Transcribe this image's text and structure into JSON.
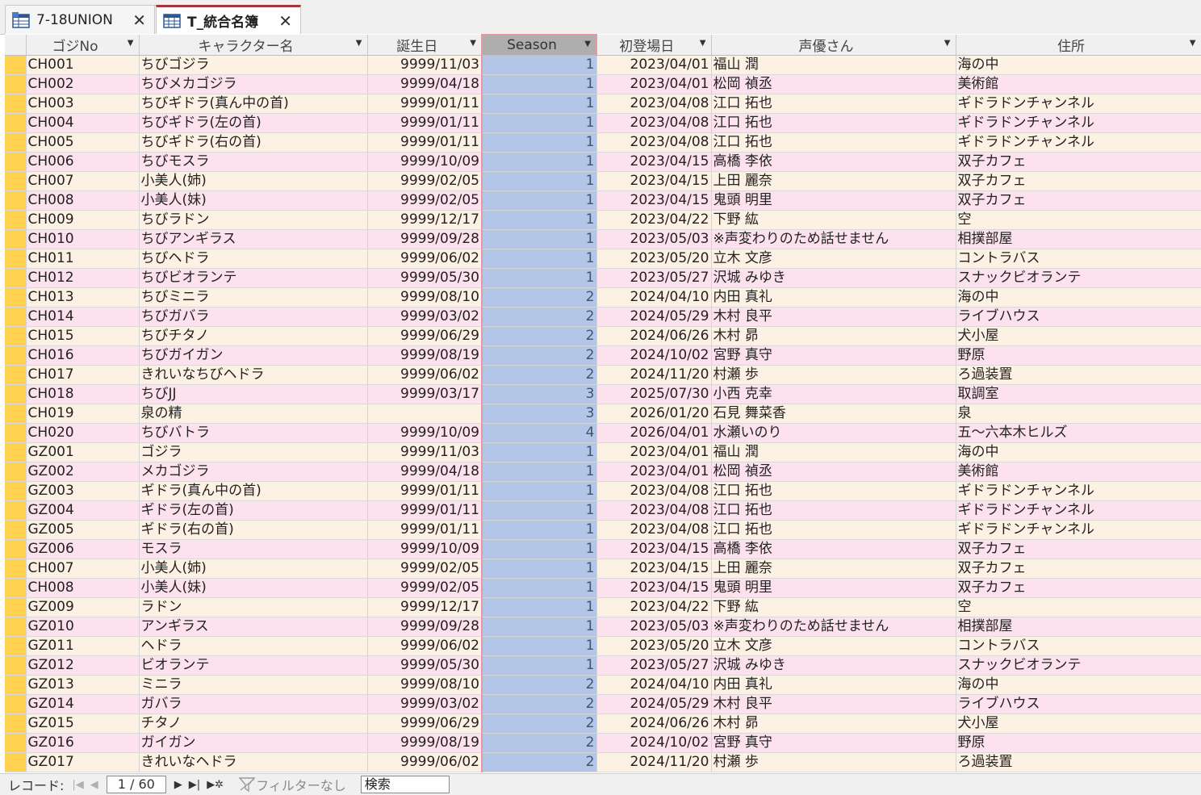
{
  "tabs": [
    {
      "label": "7-18UNION",
      "icon": "query-icon"
    },
    {
      "label": "T_統合名簿",
      "icon": "table-icon",
      "active": true
    }
  ],
  "columns": [
    "ゴジNo",
    "キャラクター名",
    "誕生日",
    "Season",
    "初登場日",
    "声優さん",
    "住所"
  ],
  "rows": [
    [
      "CH001",
      "ちびゴジラ",
      "9999/11/03",
      "1",
      "2023/04/01",
      "福山 潤",
      "海の中"
    ],
    [
      "CH002",
      "ちびメカゴジラ",
      "9999/04/18",
      "1",
      "2023/04/01",
      "松岡 禎丞",
      "美術館"
    ],
    [
      "CH003",
      "ちびギドラ(真ん中の首)",
      "9999/01/11",
      "1",
      "2023/04/08",
      "江口 拓也",
      "ギドラドンチャンネル"
    ],
    [
      "CH004",
      "ちびギドラ(左の首)",
      "9999/01/11",
      "1",
      "2023/04/08",
      "江口 拓也",
      "ギドラドンチャンネル"
    ],
    [
      "CH005",
      "ちびギドラ(右の首)",
      "9999/01/11",
      "1",
      "2023/04/08",
      "江口 拓也",
      "ギドラドンチャンネル"
    ],
    [
      "CH006",
      "ちびモスラ",
      "9999/10/09",
      "1",
      "2023/04/15",
      "高橋 李依",
      "双子カフェ"
    ],
    [
      "CH007",
      "小美人(姉)",
      "9999/02/05",
      "1",
      "2023/04/15",
      "上田 麗奈",
      "双子カフェ"
    ],
    [
      "CH008",
      "小美人(妹)",
      "9999/02/05",
      "1",
      "2023/04/15",
      "鬼頭 明里",
      "双子カフェ"
    ],
    [
      "CH009",
      "ちびラドン",
      "9999/12/17",
      "1",
      "2023/04/22",
      "下野 紘",
      "空"
    ],
    [
      "CH010",
      "ちびアンギラス",
      "9999/09/28",
      "1",
      "2023/05/03",
      "※声変わりのため話せません",
      "相撲部屋"
    ],
    [
      "CH011",
      "ちびヘドラ",
      "9999/06/02",
      "1",
      "2023/05/20",
      "立木 文彦",
      "コントラバス"
    ],
    [
      "CH012",
      "ちびビオランテ",
      "9999/05/30",
      "1",
      "2023/05/27",
      "沢城 みゆき",
      "スナックビオランテ"
    ],
    [
      "CH013",
      "ちびミニラ",
      "9999/08/10",
      "2",
      "2024/04/10",
      "内田 真礼",
      "海の中"
    ],
    [
      "CH014",
      "ちびガバラ",
      "9999/03/02",
      "2",
      "2024/05/29",
      "木村 良平",
      "ライブハウス"
    ],
    [
      "CH015",
      "ちびチタノ",
      "9999/06/29",
      "2",
      "2024/06/26",
      "木村 昴",
      "犬小屋"
    ],
    [
      "CH016",
      "ちびガイガン",
      "9999/08/19",
      "2",
      "2024/10/02",
      "宮野 真守",
      "野原"
    ],
    [
      "CH017",
      "きれいなちびヘドラ",
      "9999/06/02",
      "2",
      "2024/11/20",
      "村瀬 歩",
      "ろ過装置"
    ],
    [
      "CH018",
      "ちびJJ",
      "9999/03/17",
      "3",
      "2025/07/30",
      "小西 克幸",
      "取調室"
    ],
    [
      "CH019",
      "泉の精",
      "",
      "3",
      "2026/01/20",
      "石見 舞菜香",
      "泉"
    ],
    [
      "CH020",
      "ちびバトラ",
      "9999/10/09",
      "4",
      "2026/04/01",
      "水瀬いのり",
      "五〜六本木ヒルズ"
    ],
    [
      "GZ001",
      "ゴジラ",
      "9999/11/03",
      "1",
      "2023/04/01",
      "福山 潤",
      "海の中"
    ],
    [
      "GZ002",
      "メカゴジラ",
      "9999/04/18",
      "1",
      "2023/04/01",
      "松岡 禎丞",
      "美術館"
    ],
    [
      "GZ003",
      "ギドラ(真ん中の首)",
      "9999/01/11",
      "1",
      "2023/04/08",
      "江口 拓也",
      "ギドラドンチャンネル"
    ],
    [
      "GZ004",
      "ギドラ(左の首)",
      "9999/01/11",
      "1",
      "2023/04/08",
      "江口 拓也",
      "ギドラドンチャンネル"
    ],
    [
      "GZ005",
      "ギドラ(右の首)",
      "9999/01/11",
      "1",
      "2023/04/08",
      "江口 拓也",
      "ギドラドンチャンネル"
    ],
    [
      "GZ006",
      "モスラ",
      "9999/10/09",
      "1",
      "2023/04/15",
      "高橋 李依",
      "双子カフェ"
    ],
    [
      "CH007",
      "小美人(姉)",
      "9999/02/05",
      "1",
      "2023/04/15",
      "上田 麗奈",
      "双子カフェ"
    ],
    [
      "CH008",
      "小美人(妹)",
      "9999/02/05",
      "1",
      "2023/04/15",
      "鬼頭 明里",
      "双子カフェ"
    ],
    [
      "GZ009",
      "ラドン",
      "9999/12/17",
      "1",
      "2023/04/22",
      "下野 紘",
      "空"
    ],
    [
      "GZ010",
      "アンギラス",
      "9999/09/28",
      "1",
      "2023/05/03",
      "※声変わりのため話せません",
      "相撲部屋"
    ],
    [
      "GZ011",
      "ヘドラ",
      "9999/06/02",
      "1",
      "2023/05/20",
      "立木 文彦",
      "コントラバス"
    ],
    [
      "GZ012",
      "ビオランテ",
      "9999/05/30",
      "1",
      "2023/05/27",
      "沢城 みゆき",
      "スナックビオランテ"
    ],
    [
      "GZ013",
      "ミニラ",
      "9999/08/10",
      "2",
      "2024/04/10",
      "内田 真礼",
      "海の中"
    ],
    [
      "GZ014",
      "ガバラ",
      "9999/03/02",
      "2",
      "2024/05/29",
      "木村 良平",
      "ライブハウス"
    ],
    [
      "GZ015",
      "チタノ",
      "9999/06/29",
      "2",
      "2024/06/26",
      "木村 昴",
      "犬小屋"
    ],
    [
      "GZ016",
      "ガイガン",
      "9999/08/19",
      "2",
      "2024/10/02",
      "宮野 真守",
      "野原"
    ],
    [
      "GZ017",
      "きれいなヘドラ",
      "9999/06/02",
      "2",
      "2024/11/20",
      "村瀬 歩",
      "ろ過装置"
    ]
  ],
  "statusbar": {
    "record_label": "レコード:",
    "position": "1 / 60",
    "filter_label": "フィルターなし",
    "search_placeholder": "検索"
  },
  "colors": {
    "row_odd": "#fdf1e3",
    "row_even": "#fde2ee",
    "selected_column": "#b4c6e7",
    "record_selector": "#ffd351",
    "active_tab_accent": "#a4373a"
  }
}
